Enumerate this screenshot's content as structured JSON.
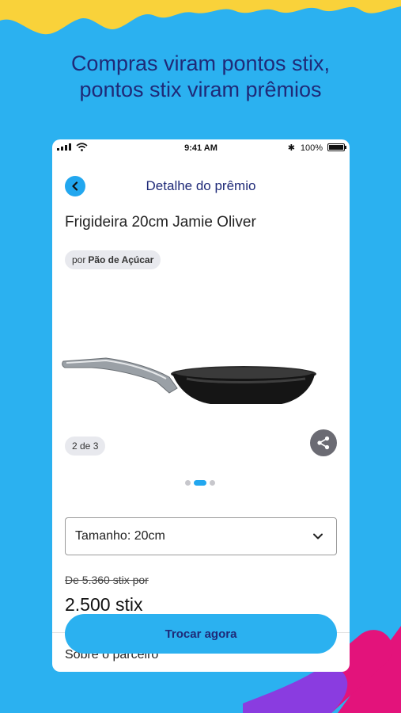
{
  "headline": {
    "line1": "Compras viram pontos stix,",
    "line2": "pontos stix viram prêmios"
  },
  "status_bar": {
    "time": "9:41 AM",
    "bluetooth": "✱",
    "battery": "100%"
  },
  "header": {
    "title": "Detalhe do prêmio",
    "back_icon": "chevron-left-icon"
  },
  "product": {
    "name": "Frigideira 20cm Jamie Oliver",
    "partner_prefix": "por",
    "partner_name": "Pão de Açúcar",
    "image_counter": "2 de 3",
    "carousel": {
      "total": 3,
      "active_index": 1
    }
  },
  "size_select": {
    "value": "Tamanho: 20cm",
    "icon": "chevron-down-icon"
  },
  "price": {
    "old": "De 5.360 stix por",
    "new": "2.500 stix"
  },
  "about_label": "Sobre o parceiro",
  "cta_label": "Trocar agora",
  "colors": {
    "background": "#2bb1f0",
    "accent": "#22a7ef",
    "title": "#1f2a78",
    "deco_yellow": "#f9d23a",
    "deco_pink": "#e3137b",
    "deco_purple": "#8a3ce0"
  }
}
